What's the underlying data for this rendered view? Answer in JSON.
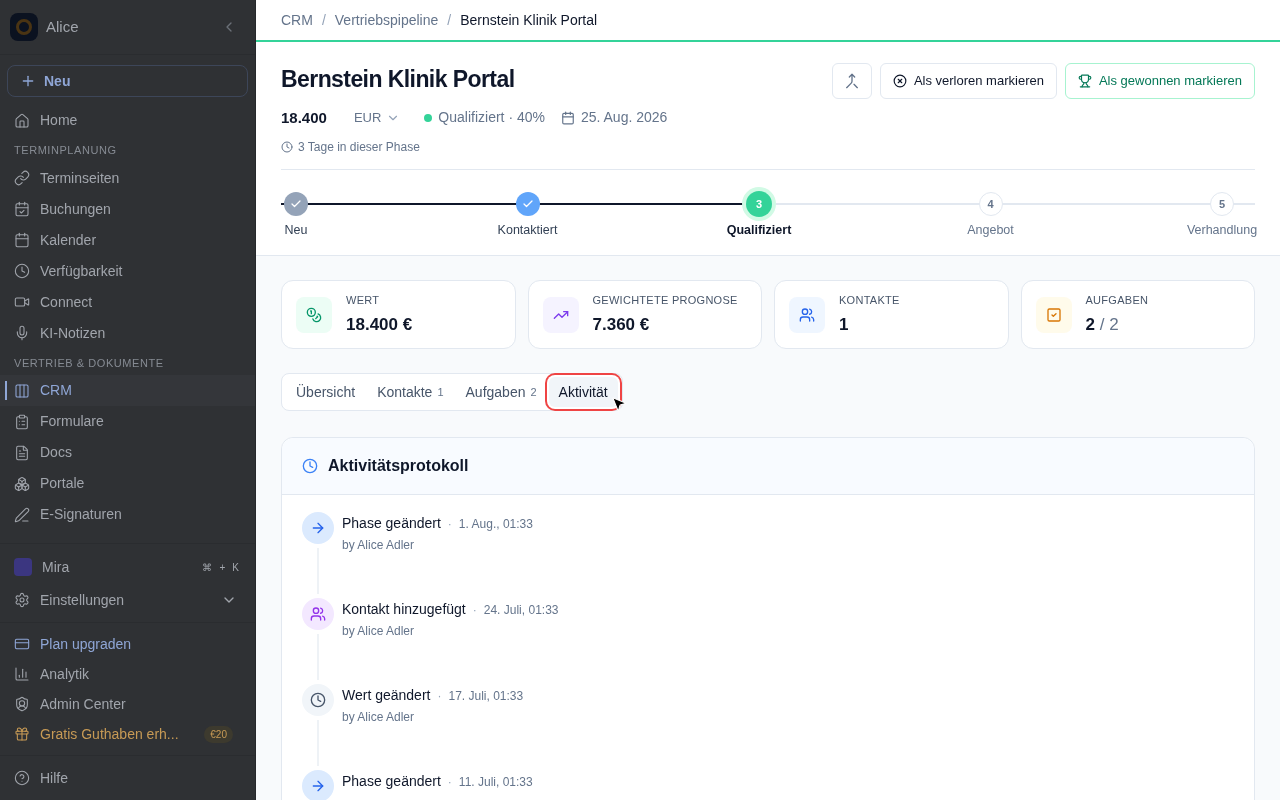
{
  "sidebar": {
    "workspace": "Alice",
    "new_button": "Neu",
    "sections": [
      {
        "items": [
          {
            "label": "Home",
            "selected": false
          }
        ]
      },
      {
        "title": "TERMINPLANUNG",
        "items": [
          {
            "label": "Terminseiten",
            "selected": false
          },
          {
            "label": "Buchungen",
            "selected": false
          },
          {
            "label": "Kalender",
            "selected": false
          },
          {
            "label": "Verfügbarkeit",
            "selected": false
          },
          {
            "label": "Connect",
            "selected": false
          },
          {
            "label": "KI-Notizen",
            "selected": false
          }
        ]
      },
      {
        "title": "VERTRIEB & DOKUMENTE",
        "items": [
          {
            "label": "CRM",
            "selected": true
          },
          {
            "label": "Formulare",
            "selected": false
          },
          {
            "label": "Docs",
            "selected": false
          },
          {
            "label": "Portale",
            "selected": false
          },
          {
            "label": "E-Signaturen",
            "selected": false
          }
        ]
      }
    ],
    "mira": {
      "label": "Mira",
      "keys": [
        "⌘",
        "+",
        "K"
      ]
    },
    "settings": "Einstellungen",
    "bottom": [
      {
        "label": "Plan upgraden",
        "kind": "upgrade"
      },
      {
        "label": "Analytik",
        "kind": "plain"
      },
      {
        "label": "Admin Center",
        "kind": "plain"
      },
      {
        "label": "Gratis Guthaben erh...",
        "kind": "gift",
        "badge": "€20"
      }
    ],
    "help": "Hilfe"
  },
  "breadcrumb": [
    {
      "label": "CRM"
    },
    {
      "separator": "/",
      "label": "Vertriebspipeline"
    },
    {
      "separator": "/",
      "label": "Bernstein Klinik Portal"
    }
  ],
  "deal": {
    "title": "Bernstein Klinik Portal",
    "amount": "18.400",
    "currency": "EUR",
    "stage": "Qualifiziert",
    "probability": "· 40%",
    "date": "25. Aug. 2026",
    "time_in_stage": "3 Tage in dieser Phase",
    "actions": [
      {
        "kind": "merge"
      },
      {
        "kind": "lost",
        "label": "Als verloren markieren"
      },
      {
        "kind": "won",
        "label": "Als gewonnen markieren"
      }
    ]
  },
  "stages": [
    {
      "label": "Neu",
      "completed": true,
      "selected": false,
      "color": "#94a3b8"
    },
    {
      "label": "Kontaktiert",
      "completed": true,
      "selected": false,
      "color": "#60a5fa"
    },
    {
      "label": "Qualifiziert",
      "completed": false,
      "selected": true,
      "number": "3",
      "color": "#34d399"
    },
    {
      "label": "Angebot",
      "completed": false,
      "selected": false,
      "number": "4",
      "color": "#ffffff"
    },
    {
      "label": "Verhandlung",
      "completed": false,
      "selected": false,
      "number": "5",
      "color": "#ffffff"
    }
  ],
  "stats": [
    {
      "label": "WERT",
      "value": "18.400 €",
      "kind": "coins"
    },
    {
      "label": "GEWICHTETE PROGNOSE",
      "value": "7.360 €",
      "kind": "trend"
    },
    {
      "label": "KONTAKTE",
      "value": "1",
      "kind": "users"
    },
    {
      "label": "AUFGABEN",
      "value": "2",
      "total": "/ 2",
      "kind": "tasks"
    }
  ],
  "tabs": [
    {
      "label": "Übersicht",
      "selected": false
    },
    {
      "label": "Kontakte",
      "count": "1",
      "selected": false
    },
    {
      "label": "Aufgaben",
      "count": "2",
      "selected": false
    },
    {
      "label": "Aktivität",
      "selected": true
    }
  ],
  "activity": {
    "title": "Aktivitätsprotokoll",
    "items": [
      {
        "kind": "phase",
        "title": "Phase geändert",
        "separator": "·",
        "time": "1. Aug., 01:33",
        "by": "by Alice Adler"
      },
      {
        "kind": "contact",
        "title": "Kontakt hinzugefügt",
        "separator": "·",
        "time": "24. Juli, 01:33",
        "by": "by Alice Adler"
      },
      {
        "kind": "value",
        "title": "Wert geändert",
        "separator": "·",
        "time": "17. Juli, 01:33",
        "by": "by Alice Adler"
      },
      {
        "kind": "phase",
        "title": "Phase geändert",
        "separator": "·",
        "time": "11. Juli, 01:33"
      }
    ]
  }
}
